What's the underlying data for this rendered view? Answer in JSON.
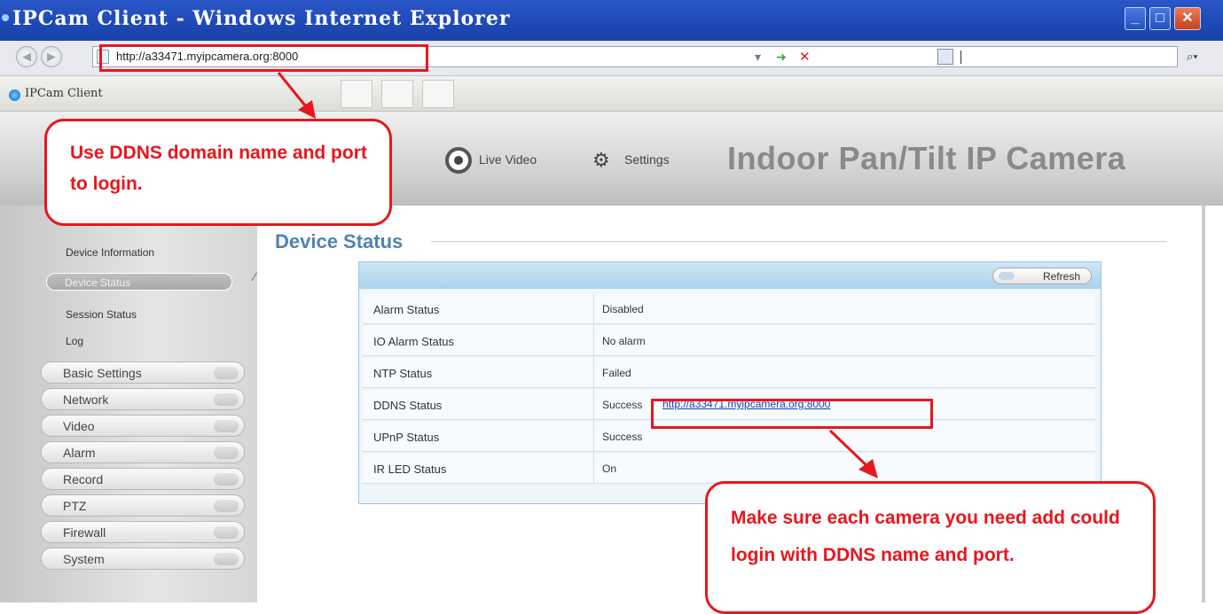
{
  "browser": {
    "window_title": "IPCam Client - Windows Internet Explorer",
    "address_url": "http://a33471.myipcamera.org:8000",
    "tab_label": "IPCam Client"
  },
  "camera": {
    "title": "Indoor Pan/Tilt IP Camera",
    "tabs": [
      "Live Video",
      "Settings"
    ]
  },
  "sidebar": {
    "sub_items": [
      "Device Information",
      "Device Status",
      "Session Status",
      "Log"
    ],
    "menu": [
      "Basic Settings",
      "Network",
      "Video",
      "Alarm",
      "Record",
      "PTZ",
      "Firewall",
      "System"
    ]
  },
  "main": {
    "section_title": "Device Status",
    "refresh_label": "Refresh",
    "rows": [
      {
        "label": "Alarm Status",
        "value": "Disabled"
      },
      {
        "label": "IO Alarm Status",
        "value": "No alarm"
      },
      {
        "label": "NTP Status",
        "value": "Failed"
      },
      {
        "label": "DDNS Status",
        "value": "Success",
        "link": "http://a33471.myipcamera.org:8000"
      },
      {
        "label": "UPnP Status",
        "value": "Success"
      },
      {
        "label": "IR LED Status",
        "value": "On"
      }
    ]
  },
  "callouts": {
    "top": "Use DDNS domain name and port to login.",
    "bottom": "Make sure each camera you need add could login with DDNS name and port."
  },
  "colors": {
    "annotation_red": "#e8161d",
    "section_blue": "#4e84b3"
  }
}
